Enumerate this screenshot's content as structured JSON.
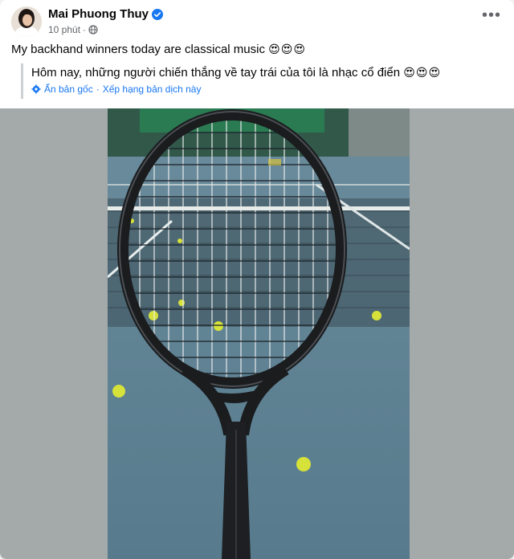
{
  "post": {
    "author": "Mai Phuong Thuy",
    "time": "10 phút",
    "separator": "·",
    "caption_text": "My backhand winners today are classical music",
    "caption_emoji": "😍😍😍",
    "translation_text": "Hôm nay, những người chiến thắng về tay trái của tôi là nhạc cổ điển",
    "translation_emoji": "😍😍😍",
    "hide_original": "Ẩn bản gốc",
    "rate_translation": "Xếp hạng bản dịch này",
    "action_separator": "·",
    "more_icon": "•••"
  },
  "colors": {
    "link": "#1877f2",
    "verified": "#1877f2",
    "secondary_text": "#65676b",
    "court": "#5d7f91",
    "wall": "#a4a9a9"
  },
  "icons": [
    "verified-badge-icon",
    "globe-icon",
    "more-options-icon",
    "translate-settings-icon"
  ]
}
